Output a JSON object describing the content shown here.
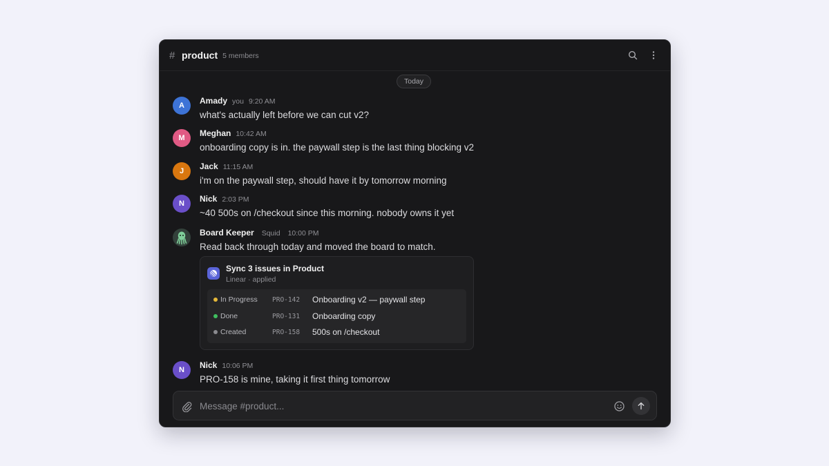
{
  "channel": {
    "hash": "#",
    "name": "product",
    "members": "5 members"
  },
  "header_icons": [
    "search-icon",
    "more-vertical-icon"
  ],
  "date_divider": "Today",
  "messages": [
    {
      "author": "Amady",
      "tag": "you",
      "time": "9:20 AM",
      "initial": "A",
      "avatar_color": "#3d73d6",
      "text": "what's actually left before we can cut v2?"
    },
    {
      "author": "Meghan",
      "time": "10:42 AM",
      "initial": "M",
      "avatar_color": "#e05a84",
      "text": "onboarding copy is in. the paywall step is the last thing blocking v2"
    },
    {
      "author": "Jack",
      "time": "11:15 AM",
      "initial": "J",
      "avatar_color": "#d9770f",
      "text": "i'm on the paywall step, should have it by tomorrow morning"
    },
    {
      "author": "Nick",
      "time": "2:03 PM",
      "initial": "N",
      "avatar_color": "#6a4fc9",
      "text": "~40 500s on /checkout since this morning. nobody owns it yet"
    },
    {
      "author": "Board Keeper",
      "tag": "Squid",
      "time": "10:00 PM",
      "avatar_icon": "squid-icon",
      "text": "Read back through today and moved the board to match."
    },
    {
      "author": "Nick",
      "time": "10:06 PM",
      "initial": "N",
      "avatar_color": "#6a4fc9",
      "text": "PRO-158 is mine, taking it first thing tomorrow"
    }
  ],
  "card": {
    "icon": "linear-icon",
    "title": "Sync 3 issues in Product",
    "subtitle": "Linear · applied",
    "rows": [
      {
        "status": "In Progress",
        "dot_color": "#e6b93a",
        "id": "PRO-142",
        "title": "Onboarding v2 — paywall step"
      },
      {
        "status": "Done",
        "dot_color": "#3fbf5f",
        "id": "PRO-131",
        "title": "Onboarding copy"
      },
      {
        "status": "Created",
        "dot_color": "#8a8a8f",
        "id": "PRO-158",
        "title": "500s on /checkout"
      }
    ]
  },
  "composer": {
    "placeholder": "Message #product...",
    "value": "",
    "icons": [
      "paperclip-icon",
      "smiley-icon",
      "send-arrow-icon"
    ]
  }
}
